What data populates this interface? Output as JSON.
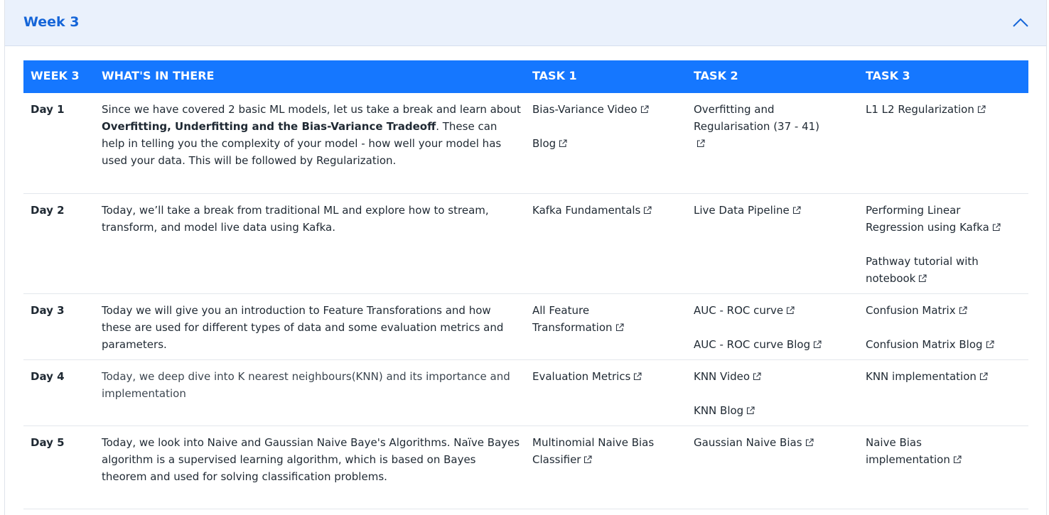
{
  "panel": {
    "title": "Week 3"
  },
  "headers": [
    "WEEK 3",
    "WHAT'S IN THERE",
    "TASK 1",
    "TASK 2",
    "TASK 3"
  ],
  "rows": [
    {
      "day": "Day 1",
      "desc_pre": "Since we have covered 2 basic ML models, let us take a break and learn about ",
      "desc_bold": "Overfitting, Underfitting and the Bias-Variance Tradeoff",
      "desc_post": ". These can help in telling you the complexity of your model - how well your model has used your data. This will be followed by Regularization.",
      "task1": [
        "Bias-Variance Video",
        "Blog"
      ],
      "task2": [
        "Overfitting and Regularisation (37 - 41)"
      ],
      "task3": [
        "L1 L2 Regularization"
      ]
    },
    {
      "day": "Day 2",
      "desc": "Today, we’ll take a break from traditional ML and explore how to stream, transform, and model live data using Kafka.",
      "task1": [
        "Kafka Fundamentals"
      ],
      "task2": [
        "Live Data Pipeline"
      ],
      "task3": [
        "Performing Linear Regression using Kafka",
        "Pathway tutorial with notebook"
      ]
    },
    {
      "day": "Day 3",
      "desc": "Today we will give you an introduction to Feature Transforations and how these are used for different types of data and some evaluation metrics and parameters.",
      "task1": [
        "All Feature Transformation"
      ],
      "task2": [
        "AUC - ROC curve",
        "AUC - ROC curve Blog"
      ],
      "task3": [
        "Confusion Matrix",
        "Confusion Matrix Blog"
      ]
    },
    {
      "day": "Day 4",
      "desc": "Today, we deep dive into K nearest neighbours(KNN) and its importance and implementation",
      "task1": [
        "Evaluation Metrics"
      ],
      "task2": [
        "KNN Video",
        "KNN Blog"
      ],
      "task3": [
        "KNN implementation"
      ]
    },
    {
      "day": "Day 5",
      "desc": "Today, we look into Naive and Gaussian Naive Baye's Algorithms. Naïve Bayes algorithm is a supervised learning algorithm, which is based on Bayes theorem and used for solving classification problems.",
      "task1": [
        "Multinomial Naive Bias Classifier"
      ],
      "task2": [
        "Gaussian Naive Bias"
      ],
      "task3": [
        "Naive Bias implementation"
      ]
    }
  ]
}
